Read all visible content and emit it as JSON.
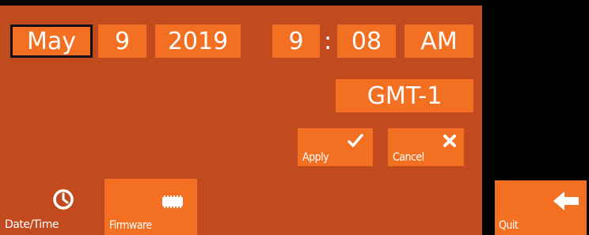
{
  "date": {
    "month": "May",
    "day": "9",
    "year": "2019"
  },
  "time": {
    "hour": "9",
    "separator": ":",
    "minute": "08",
    "ampm": "AM"
  },
  "timezone": "GMT-1",
  "actions": {
    "apply_label": "Apply",
    "cancel_label": "Cancel"
  },
  "tabs": {
    "datetime_label": "Date/Time",
    "firmware_label": "Firmware",
    "quit_label": "Quit"
  },
  "icons": {
    "apply": "checkmark-icon",
    "cancel": "x-icon",
    "datetime": "clock-icon",
    "firmware": "chip-icon",
    "quit": "left-arrow-icon"
  },
  "colors": {
    "panel": "#c14a1e",
    "button": "#f36f21",
    "background": "#000000",
    "text": "#ffffff"
  }
}
